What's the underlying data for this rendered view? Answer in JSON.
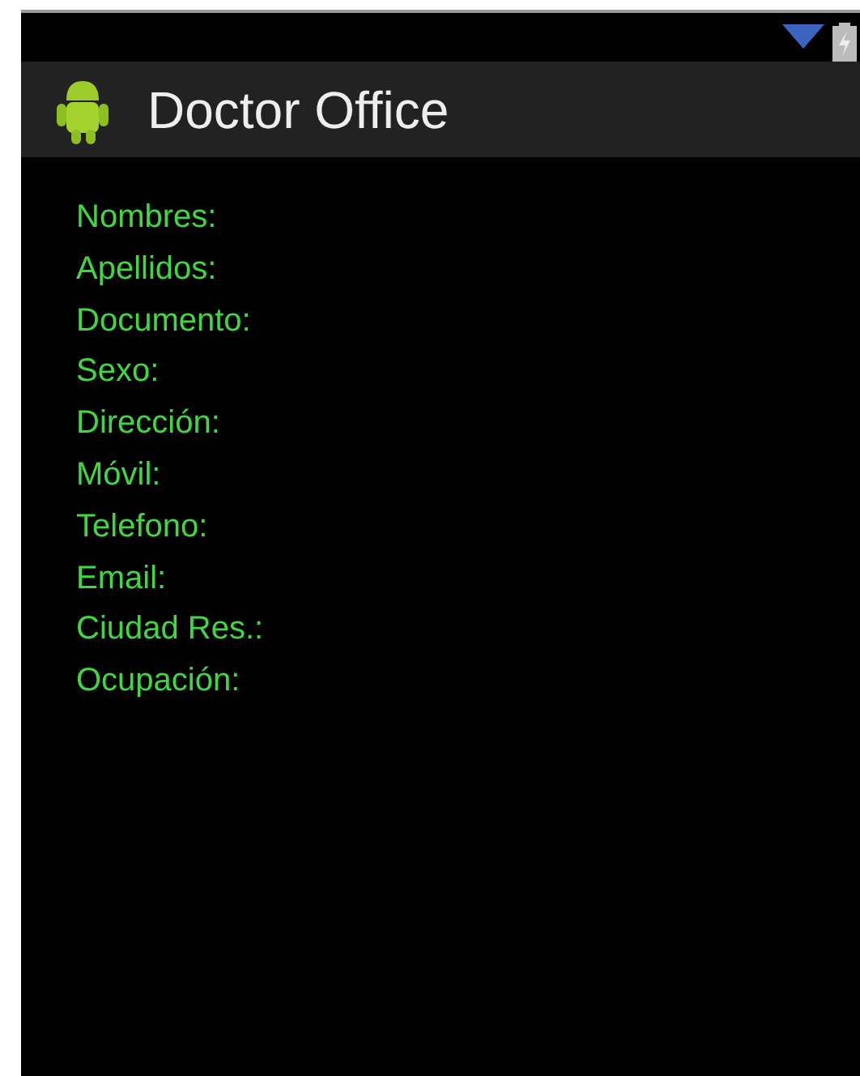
{
  "app_bar": {
    "title": "Doctor Office"
  },
  "fields": [
    {
      "label": "Nombres:"
    },
    {
      "label": "Apellidos:"
    },
    {
      "label": "Documento:"
    },
    {
      "label": "Sexo:"
    },
    {
      "label": "Dirección:"
    },
    {
      "label": "Móvil:"
    },
    {
      "label": "Telefono:"
    },
    {
      "label": "Email:"
    },
    {
      "label": "Ciudad Res.:"
    },
    {
      "label": "Ocupación:"
    }
  ]
}
